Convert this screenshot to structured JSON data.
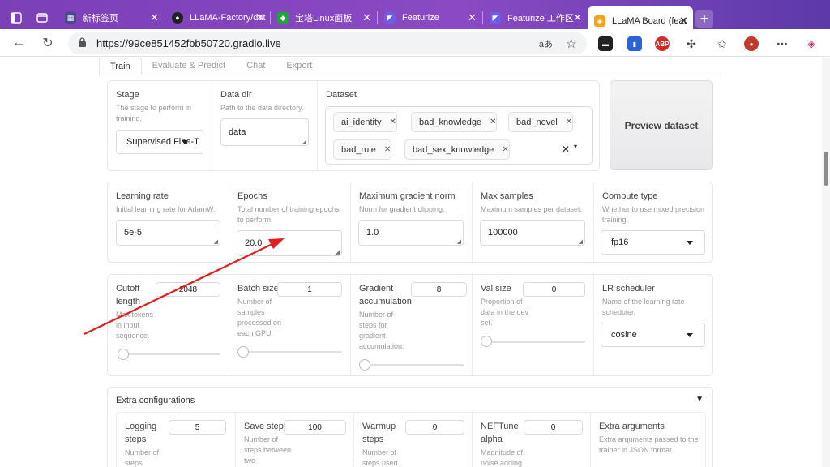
{
  "browser": {
    "tabs": [
      {
        "title": "新标签页",
        "icon": "new-tab-page-icon",
        "color": "#4a4a8a"
      },
      {
        "title": "LLaMA-Factory/dat",
        "icon": "github-icon",
        "color": "#222222"
      },
      {
        "title": "宝塔Linux面板",
        "icon": "baota-shield-icon",
        "color": "#20a53a"
      },
      {
        "title": "Featurize",
        "icon": "featurize-icon",
        "color": "#6c5ce7"
      },
      {
        "title": "Featurize 工作区",
        "icon": "featurize-icon",
        "color": "#6c5ce7"
      },
      {
        "title": "LLaMA Board (feat",
        "icon": "gradio-icon",
        "color": "#f7a21b"
      }
    ],
    "url": "https://99ce851452fbb50720.gradio.live",
    "read_aloud_glyph": "aあ",
    "extensions": [
      "media-icon",
      "bookmark-ext-icon",
      "adblock-icon",
      "puzzle-icon"
    ],
    "adblock_label": "ABP"
  },
  "app": {
    "tabs": [
      "Train",
      "Evaluate & Predict",
      "Chat",
      "Export"
    ],
    "active_tab": "Train",
    "stage": {
      "label": "Stage",
      "info": "The stage to perform in training.",
      "value": "Supervised Fine-T"
    },
    "data_dir": {
      "label": "Data dir",
      "info": "Path to the data directory.",
      "value": "data"
    },
    "dataset": {
      "label": "Dataset",
      "selected": [
        "ai_identity",
        "bad_knowledge",
        "bad_novel",
        "bad_rule",
        "bad_sex_knowledge"
      ]
    },
    "preview_button": "Preview dataset",
    "learning_rate": {
      "label": "Learning rate",
      "info": "Initial learning rate for AdamW.",
      "value": "5e-5"
    },
    "epochs": {
      "label": "Epochs",
      "info": "Total number of training epochs to perform.",
      "value": "20.0"
    },
    "max_grad_norm": {
      "label": "Maximum gradient norm",
      "info": "Norm for gradient clipping.",
      "value": "1.0"
    },
    "max_samples": {
      "label": "Max samples",
      "info": "Maximum samples per dataset.",
      "value": "100000"
    },
    "compute_type": {
      "label": "Compute type",
      "info": "Whether to use mixed precision training.",
      "value": "fp16"
    },
    "cutoff_length": {
      "label": "Cutoff length",
      "info": "Max tokens in input sequence.",
      "value": "2048",
      "fraction": 0.0
    },
    "batch_size": {
      "label": "Batch size",
      "info": "Number of samples processed on each GPU.",
      "value": "1",
      "fraction": 0.0
    },
    "grad_accum": {
      "label": "Gradient accumulation",
      "info": "Number of steps for gradient accumulation.",
      "value": "8",
      "fraction": 0.0
    },
    "val_size": {
      "label": "Val size",
      "info": "Proportion of data in the dev set.",
      "value": "0",
      "fraction": 0.0
    },
    "lr_scheduler": {
      "label": "LR scheduler",
      "info": "Name of the learning rate scheduler.",
      "value": "cosine"
    },
    "extra": {
      "title": "Extra configurations",
      "toggle_glyph": "▼",
      "logging_steps": {
        "label": "Logging steps",
        "info": "Number of steps",
        "value": "5"
      },
      "save_steps": {
        "label": "Save steps",
        "info": "Number of steps between two",
        "value": "100"
      },
      "warmup_steps": {
        "label": "Warmup steps",
        "info": "Number of steps used",
        "value": "0"
      },
      "neftune_alpha": {
        "label": "NEFTune alpha",
        "info": "Magnitude of noise adding",
        "value": "0"
      },
      "extra_arguments": {
        "label": "Extra arguments",
        "info": "Extra arguments passed to the trainer in JSON format."
      }
    }
  },
  "annotation": {
    "arrow_color": "#e02020"
  }
}
